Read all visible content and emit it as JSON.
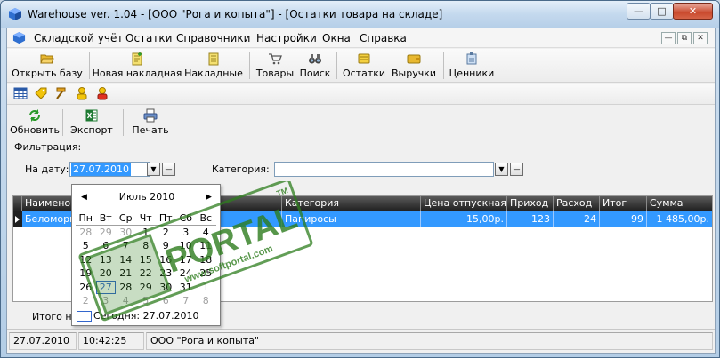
{
  "window": {
    "title": "Warehouse ver. 1.04 - [ООО \"Рога и копыта\"] - [Остатки товара на складе]"
  },
  "menu": [
    "Складской учёт",
    "Остатки",
    "Справочники",
    "Настройки",
    "Окна",
    "Справка"
  ],
  "toolbar1": {
    "open": "Открыть базу",
    "new_invoice": "Новая накладная",
    "invoices": "Накладные",
    "goods": "Товары",
    "search": "Поиск",
    "remains": "Остатки",
    "revenue": "Выручки",
    "price_tags": "Ценники"
  },
  "toolbar3": {
    "refresh": "Обновить",
    "export": "Экспорт",
    "print": "Печать"
  },
  "filter": {
    "group": "Фильтрация:",
    "date_label": "На дату:",
    "date_value": "27.07.2010",
    "category_label": "Категория:"
  },
  "grid": {
    "columns": [
      "Наименование",
      "Категория",
      "Цена отпускная",
      "Приход",
      "Расход",
      "Итог",
      "Сумма"
    ],
    "rows": [
      {
        "name": "Беломорканал",
        "category": "Папиросы",
        "price": "15,00р.",
        "in": "123",
        "out": "24",
        "total": "99",
        "sum": "1 485,00р."
      }
    ]
  },
  "footer": {
    "total_label": "Итого на"
  },
  "calendar": {
    "month": "Июль 2010",
    "weekdays": [
      "Пн",
      "Вт",
      "Ср",
      "Чт",
      "Пт",
      "Сб",
      "Вс"
    ],
    "weeks": [
      [
        "28",
        "29",
        "30",
        "1",
        "2",
        "3",
        "4"
      ],
      [
        "5",
        "6",
        "7",
        "8",
        "9",
        "10",
        "11"
      ],
      [
        "12",
        "13",
        "14",
        "15",
        "16",
        "17",
        "18"
      ],
      [
        "19",
        "20",
        "21",
        "22",
        "23",
        "24",
        "25"
      ],
      [
        "26",
        "27",
        "28",
        "29",
        "30",
        "31",
        "1"
      ],
      [
        "2",
        "3",
        "4",
        "5",
        "6",
        "7",
        "8"
      ]
    ],
    "today": "Сегодня: 27.07.2010"
  },
  "status": {
    "date": "27.07.2010",
    "time": "10:42:25",
    "company": "ООО \"Рога и копыта\""
  },
  "watermark": {
    "text": "PORTAL",
    "url": "www.softportal.com",
    "tm": "TM"
  }
}
